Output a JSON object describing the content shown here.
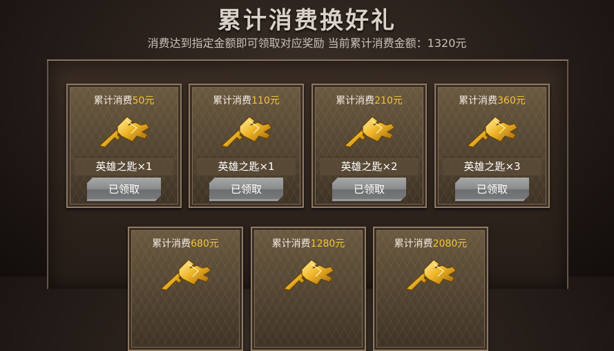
{
  "title": "累计消费换好礼",
  "subtitle": "消费达到指定金额即可领取对应奖励 当前累计消费金额：1320元",
  "cards": [
    {
      "label": "累计消费",
      "amount": "50元",
      "reward": "英雄之匙×1",
      "button": "已领取"
    },
    {
      "label": "累计消费",
      "amount": "110元",
      "reward": "英雄之匙×1",
      "button": "已领取"
    },
    {
      "label": "累计消费",
      "amount": "210元",
      "reward": "英雄之匙×2",
      "button": "已领取"
    },
    {
      "label": "累计消费",
      "amount": "360元",
      "reward": "英雄之匙×3",
      "button": "已领取"
    },
    {
      "label": "累计消费",
      "amount": "680元"
    },
    {
      "label": "累计消费",
      "amount": "1280元"
    },
    {
      "label": "累计消费",
      "amount": "2080元"
    }
  ],
  "colors": {
    "amount": "#f5c43a",
    "key_gold": "#e0a91f",
    "button": "#8a8b8c"
  },
  "icon": "golden-key-icon"
}
